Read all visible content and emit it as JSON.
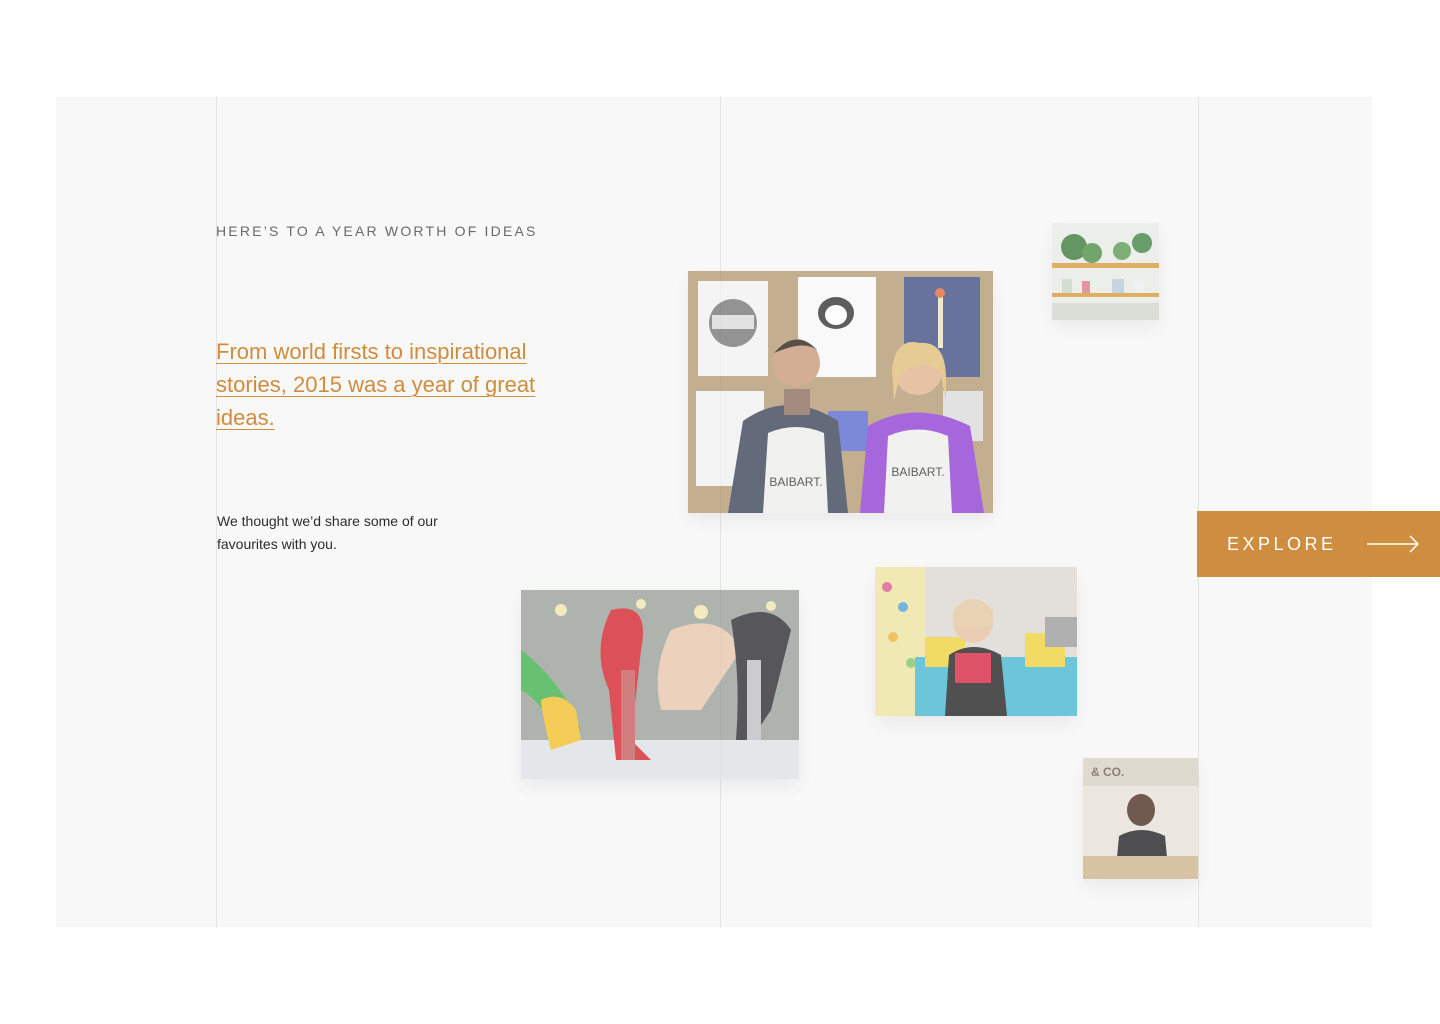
{
  "intro": {
    "eyebrow": "HERE’S TO A YEAR WORTH OF IDEAS",
    "headline": "From world firsts to inspirational stories, 2015 was a year of great ideas.",
    "body": "We thought we’d share some of our favourites with you."
  },
  "cta": {
    "explore_label": "EXPLORE",
    "icon": "arrow-right-icon"
  },
  "photos": [
    {
      "id": "bakers",
      "apron_text": "BAIBART."
    },
    {
      "id": "plants-shelf"
    },
    {
      "id": "shoes"
    },
    {
      "id": "woman-sofa"
    },
    {
      "id": "woman-table",
      "sign_text": "& CO."
    }
  ],
  "colors": {
    "accent": "#cf8e3f",
    "panel": "#f8f8f8",
    "guide": "#e4e4e4"
  }
}
